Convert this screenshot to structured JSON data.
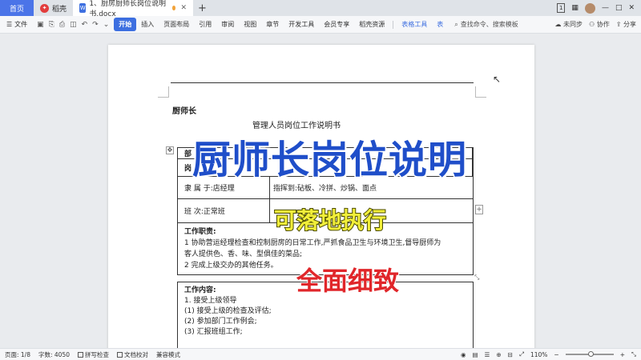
{
  "tabbar": {
    "home": "首页",
    "tabs": [
      {
        "label": "稻壳",
        "icon": "dock-icon"
      },
      {
        "label": "1、厨房厨师长岗位说明书.docx",
        "icon": "word-doc-icon"
      }
    ],
    "new_tab": "+",
    "window_badge": "1",
    "win_controls": [
      "—",
      "□",
      "✕"
    ]
  },
  "menubar": {
    "file": "文件",
    "items": [
      "开始",
      "插入",
      "页面布局",
      "引用",
      "审阅",
      "视图",
      "章节",
      "开发工具",
      "会员专享",
      "稻壳资源",
      "表格工具",
      "表"
    ],
    "search": "查找命令、搜索模板",
    "right": [
      "未同步",
      "协作",
      "分享"
    ]
  },
  "document": {
    "heading_small": "厨师长",
    "heading_center": "管理人员岗位工作说明书",
    "table1": {
      "row0_col1": "部",
      "row1_col1": "岗",
      "row2_col1": "隶 属 于:店经理",
      "row2_col2": "指挥到:砧板、冷拼、炒锅、面点",
      "row3_col1": "班 次:正常班",
      "duties_title": "工作职责:",
      "duties": [
        "1  协助营运经理检查和控制厨房的日常工作,严抓食品卫生与环境卫生,督导厨师为",
        "   客人提供色、香、味、型俱佳的菜品;",
        "2  完成上级交办的其他任务。"
      ]
    },
    "table2": {
      "title": "工作内容:",
      "lines": [
        "1.  接受上级领导",
        "(1) 接受上级的检查及评估;",
        "(2) 参加部门工作例会;",
        "(3) 汇报班组工作;"
      ]
    }
  },
  "overlays": {
    "title": "厨师长岗位说明",
    "sub1": "可落地执行",
    "sub2": "全面细致"
  },
  "statusbar": {
    "page": "页面: 1/8",
    "words": "字数: 4050",
    "spell": "拼写检查",
    "proof": "文档校对",
    "compat": "兼容模式",
    "zoom": "110%"
  }
}
